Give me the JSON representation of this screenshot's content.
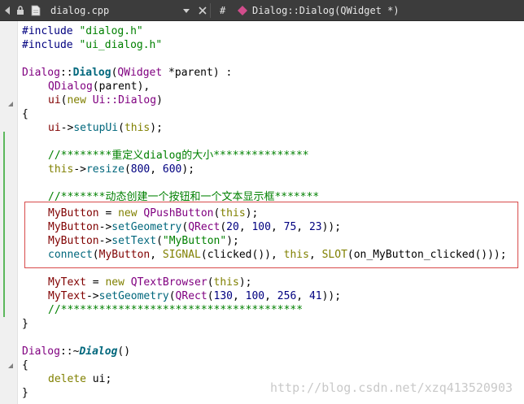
{
  "topbar": {
    "file_name": "dialog.cpp",
    "hash_symbol": "#",
    "symbol_name": "Dialog::Dialog(QWidget *)"
  },
  "code": {
    "l1_pp": "#include",
    "l1_str": "\"dialog.h\"",
    "l2_pp": "#include",
    "l2_str": "\"ui_dialog.h\"",
    "l4_cls": "Dialog",
    "l4_sep": "::",
    "l4_fn": "Dialog",
    "l4_rest_open": "(",
    "l4_type": "QWidget",
    "l4_rest_close": " *parent) :",
    "l5_cls": "QDialog",
    "l5_rest": "(parent),",
    "l6_mem": "ui",
    "l6_open": "(",
    "l6_kw": "new",
    "l6_cls": " Ui::Dialog",
    "l6_close": ")",
    "l7": "{",
    "l8_mem": "ui",
    "l8_arrow": "->",
    "l8_fn": "setupUi",
    "l8_open": "(",
    "l8_kw": "this",
    "l8_close": ");",
    "l10_cmt": "//********重定义dialog的大小***************",
    "l11_kw": "this",
    "l11_arrow": "->",
    "l11_fn": "resize",
    "l11_open": "(",
    "l11_n1": "800",
    "l11_comma": ", ",
    "l11_n2": "600",
    "l11_close": ");",
    "l13_cmt": "//*******动态创建一个按钮和一个文本显示框*******",
    "l14_var": "MyButton",
    "l14_eq": " = ",
    "l14_kw": "new",
    "l14_cls": " QPushButton",
    "l14_open": "(",
    "l14_this": "this",
    "l14_close": ");",
    "l15_var": "MyButton",
    "l15_arrow": "->",
    "l15_fn": "setGeometry",
    "l15_open": "(",
    "l15_cls": "QRect",
    "l15_args_open": "(",
    "l15_n1": "20",
    "l15_c1": ", ",
    "l15_n2": "100",
    "l15_c2": ", ",
    "l15_n3": "75",
    "l15_c3": ", ",
    "l15_n4": "23",
    "l15_close": "));",
    "l16_var": "MyButton",
    "l16_arrow": "->",
    "l16_fn": "setText",
    "l16_open": "(",
    "l16_str": "\"MyButton\"",
    "l16_close": ");",
    "l17_fn": "connect",
    "l17_open": "(",
    "l17_var": "MyButton",
    "l17_c1": ", ",
    "l17_sig": "SIGNAL",
    "l17_sigargs": "(clicked()), ",
    "l17_this": "this",
    "l17_c2": ", ",
    "l17_slot": "SLOT",
    "l17_slotargs": "(on_MyButton_clicked()));",
    "l19_var": "MyText",
    "l19_eq": " = ",
    "l19_kw": "new",
    "l19_cls": " QTextBrowser",
    "l19_open": "(",
    "l19_this": "this",
    "l19_close": ");",
    "l20_var": "MyText",
    "l20_arrow": "->",
    "l20_fn": "setGeometry",
    "l20_open": "(",
    "l20_cls": "QRect",
    "l20_args_open": "(",
    "l20_n1": "130",
    "l20_c1": ", ",
    "l20_n2": "100",
    "l20_c2": ", ",
    "l20_n3": "256",
    "l20_c3": ", ",
    "l20_n4": "41",
    "l20_close": "));",
    "l21_cmt": "//**************************************",
    "l22": "}",
    "l24_cls": "Dialog",
    "l24_sep": "::~",
    "l24_fn": "Dialog",
    "l24_rest": "()",
    "l25": "{",
    "l26_kw": "delete",
    "l26_rest": " ui;",
    "l27": "}"
  },
  "watermark": "http://blog.csdn.net/xzq413520903"
}
